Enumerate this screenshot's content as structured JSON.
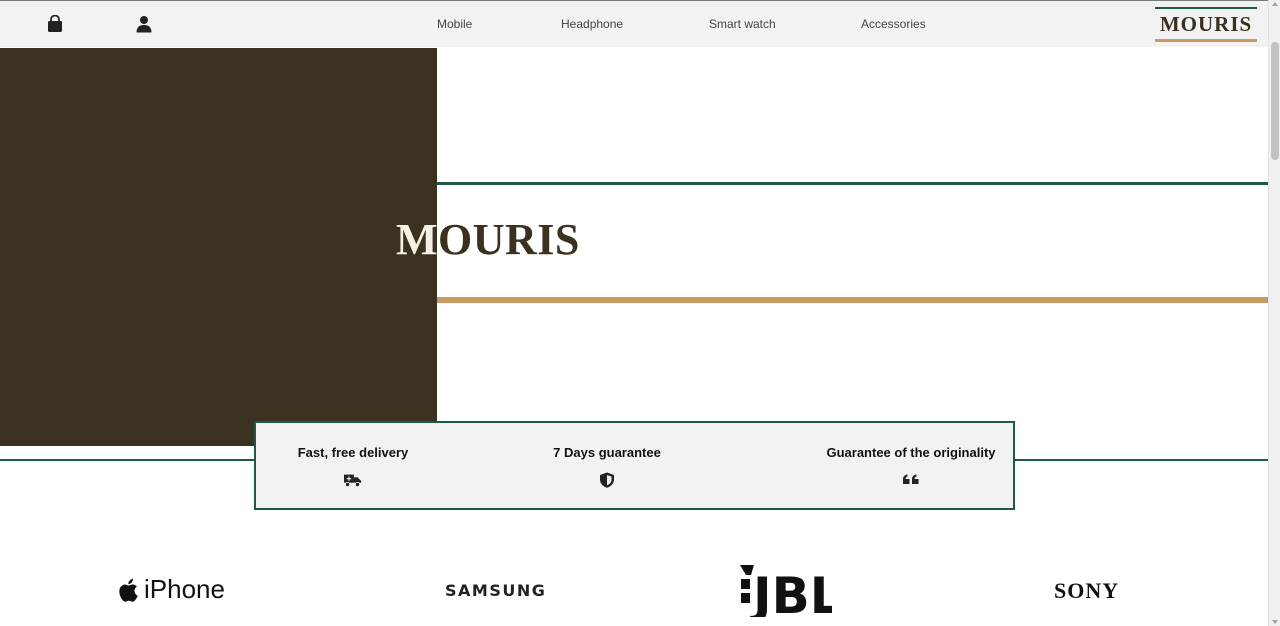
{
  "header": {
    "nav_links": [
      "Mobile",
      "Headphone",
      "Smart watch",
      "Accessories"
    ],
    "logo": "MOURIS",
    "icons": [
      "shopping-bag-icon",
      "user-icon"
    ]
  },
  "hero": {
    "title_light": "M",
    "title_dark": "OURIS"
  },
  "features": [
    {
      "title": "Fast, free delivery",
      "icon": "delivery-truck-icon"
    },
    {
      "title": "7 Days guarantee",
      "icon": "shield-icon"
    },
    {
      "title": "Guarantee of the originality",
      "icon": "quote-icon"
    }
  ],
  "brands": {
    "iphone": "iPhone",
    "samsung": "SAMSUNG",
    "jbl": "JBL",
    "sony": "SONY"
  },
  "colors": {
    "dark_brown": "#3a3120",
    "green": "#1f5a44",
    "gold": "#c99a64",
    "light_gray": "#f2f2f2"
  }
}
